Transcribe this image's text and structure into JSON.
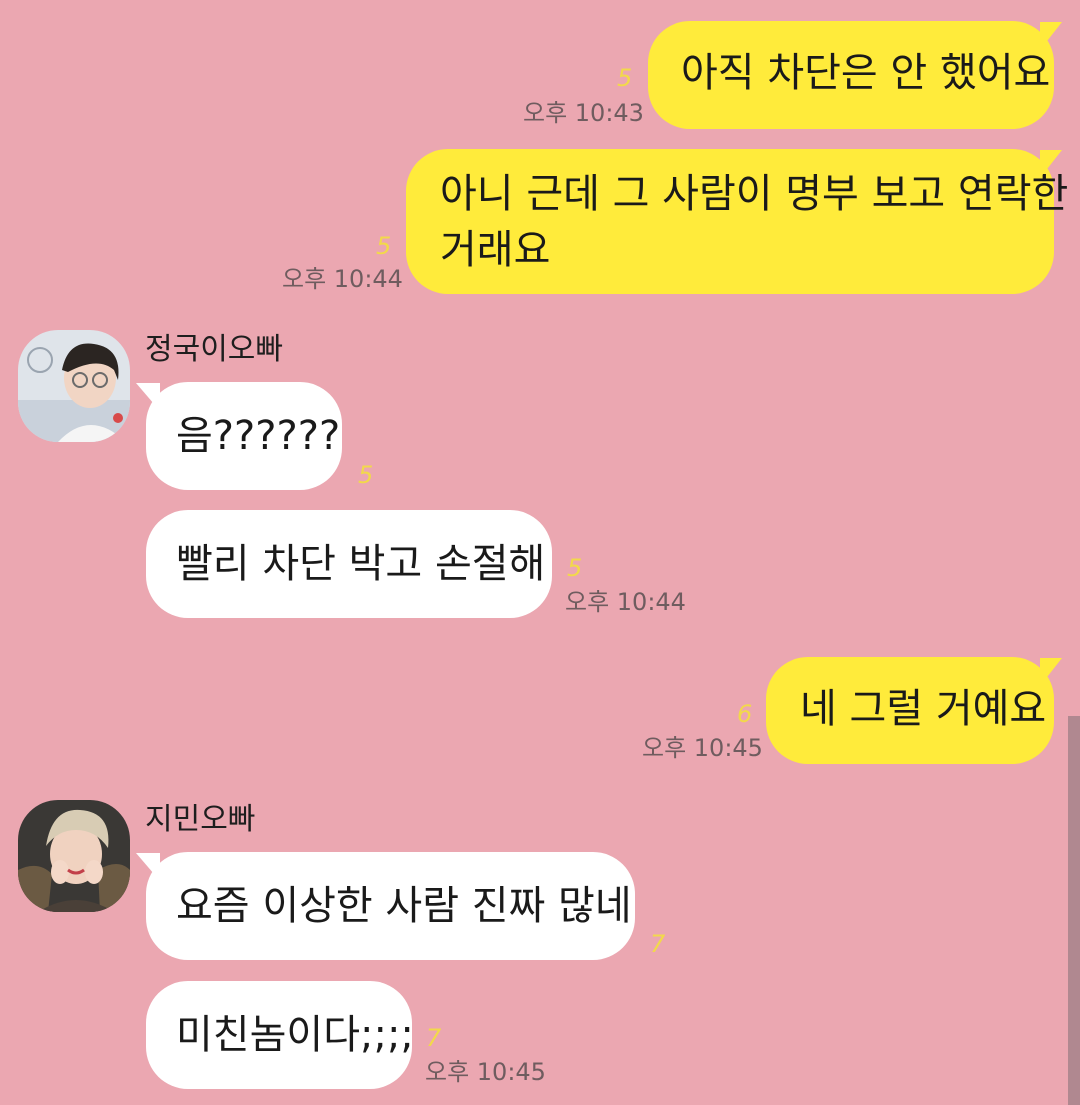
{
  "messages": [
    {
      "text": "아직 차단은 안 했어요",
      "unread": "5",
      "time": "오후 10:43"
    },
    {
      "line1": "아니 근데 그 사람이 명부 보고 연락한",
      "line2": "거래요",
      "unread": "5",
      "time": "오후 10:44"
    },
    {
      "sender": "정국이오빠",
      "text": "음??????",
      "unread": "5"
    },
    {
      "text": "빨리 차단 박고 손절해",
      "unread": "5",
      "time": "오후 10:44"
    },
    {
      "text": "네 그럴 거예요",
      "unread": "6",
      "time": "오후 10:45"
    },
    {
      "sender": "지민오빠",
      "text": "요즘 이상한 사람 진짜 많네",
      "unread": "7"
    },
    {
      "text": "미친놈이다;;;;",
      "unread": "7",
      "time": "오후 10:45"
    }
  ],
  "colors": {
    "background": "#eba7b1",
    "my_bubble": "#ffeb3b",
    "their_bubble": "#ffffff",
    "unread": "#f2d94a"
  }
}
